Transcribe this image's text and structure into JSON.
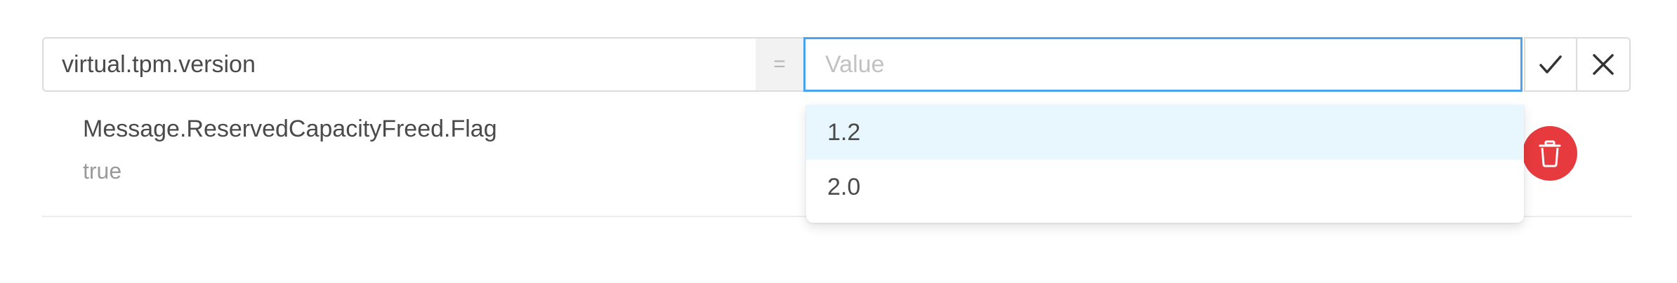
{
  "editor": {
    "key_value": "virtual.tpm.version",
    "separator": "=",
    "value_placeholder": "Value",
    "confirm_icon": "check-icon",
    "cancel_icon": "close-icon",
    "focus_color": "#4aa3f0"
  },
  "dropdown": {
    "options": [
      {
        "label": "1.2",
        "highlighted": true
      },
      {
        "label": "2.0",
        "highlighted": false
      }
    ],
    "highlight_color": "#e8f6fd"
  },
  "entries": [
    {
      "key": "Message.ReservedCapacityFreed.Flag",
      "value": "true",
      "delete_icon": "trash-icon",
      "delete_color": "#e63a3e"
    }
  ]
}
